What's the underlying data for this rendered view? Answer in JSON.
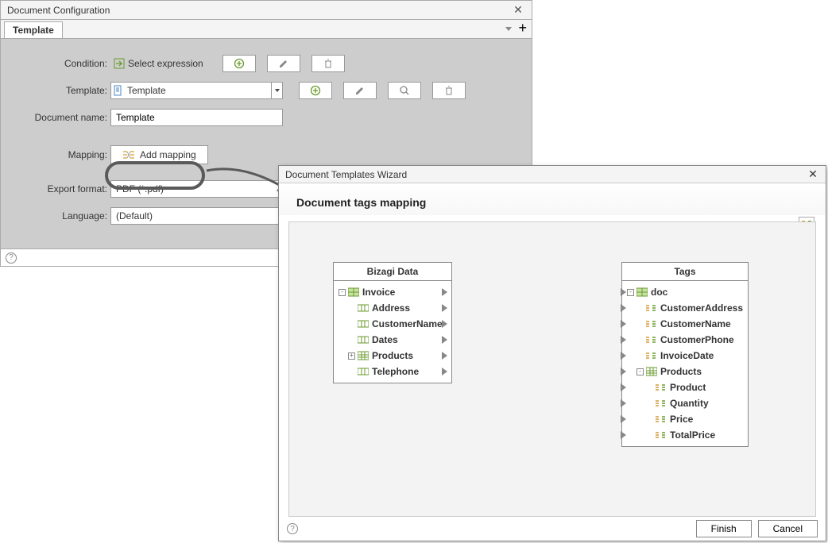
{
  "config": {
    "title": "Document Configuration",
    "tab": "Template",
    "fields": {
      "condition_label": "Condition:",
      "condition_action": "Select expression",
      "template_label": "Template:",
      "template_value": "Template",
      "docname_label": "Document name:",
      "docname_value": "Template",
      "mapping_label": "Mapping:",
      "mapping_action": "Add mapping",
      "export_label": "Export format:",
      "export_value": "PDF (*.pdf)",
      "language_label": "Language:",
      "language_value": "(Default)"
    }
  },
  "wizard": {
    "title": "Document Templates Wizard",
    "heading": "Document tags mapping",
    "left_panel": {
      "title": "Bizagi Data",
      "nodes": [
        {
          "label": "Invoice",
          "depth": 0,
          "exp": "-",
          "icon": "doc"
        },
        {
          "label": "Address",
          "depth": 1,
          "exp": "",
          "icon": "field"
        },
        {
          "label": "CustomerName",
          "depth": 1,
          "exp": "",
          "icon": "field"
        },
        {
          "label": "Dates",
          "depth": 1,
          "exp": "",
          "icon": "field"
        },
        {
          "label": "Products",
          "depth": 1,
          "exp": "+",
          "icon": "table"
        },
        {
          "label": "Telephone",
          "depth": 1,
          "exp": "",
          "icon": "field"
        }
      ]
    },
    "right_panel": {
      "title": "Tags",
      "nodes": [
        {
          "label": "doc",
          "depth": 0,
          "exp": "-",
          "icon": "doc"
        },
        {
          "label": "CustomerAddress",
          "depth": 1,
          "exp": "",
          "icon": "tag"
        },
        {
          "label": "CustomerName",
          "depth": 1,
          "exp": "",
          "icon": "tag"
        },
        {
          "label": "CustomerPhone",
          "depth": 1,
          "exp": "",
          "icon": "tag"
        },
        {
          "label": "InvoiceDate",
          "depth": 1,
          "exp": "",
          "icon": "tag"
        },
        {
          "label": "Products",
          "depth": 1,
          "exp": "-",
          "icon": "table"
        },
        {
          "label": "Product",
          "depth": 2,
          "exp": "",
          "icon": "tag"
        },
        {
          "label": "Quantity",
          "depth": 2,
          "exp": "",
          "icon": "tag"
        },
        {
          "label": "Price",
          "depth": 2,
          "exp": "",
          "icon": "tag"
        },
        {
          "label": "TotalPrice",
          "depth": 2,
          "exp": "",
          "icon": "tag"
        }
      ]
    },
    "buttons": {
      "finish": "Finish",
      "cancel": "Cancel"
    }
  }
}
